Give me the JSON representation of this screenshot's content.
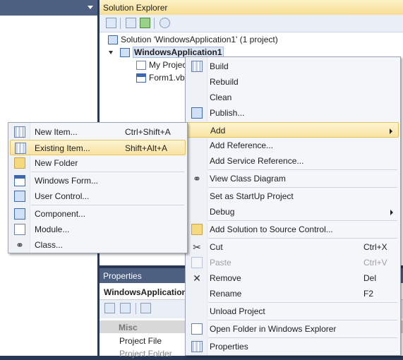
{
  "solution_explorer": {
    "title": "Solution Explorer",
    "tree": {
      "solution": "Solution 'WindowsApplication1' (1 project)",
      "project": "WindowsApplication1",
      "item1": "My Projec",
      "item2": "Form1.vb"
    }
  },
  "context_menu": {
    "items": [
      {
        "label": "Build"
      },
      {
        "label": "Rebuild"
      },
      {
        "label": "Clean"
      },
      {
        "label": "Publish..."
      },
      {
        "label": "Add"
      },
      {
        "label": "Add Reference..."
      },
      {
        "label": "Add Service Reference..."
      },
      {
        "label": "View Class Diagram"
      },
      {
        "label": "Set as StartUp Project"
      },
      {
        "label": "Debug"
      },
      {
        "label": "Add Solution to Source Control..."
      },
      {
        "label": "Cut",
        "shortcut": "Ctrl+X"
      },
      {
        "label": "Paste",
        "shortcut": "Ctrl+V"
      },
      {
        "label": "Remove",
        "shortcut": "Del"
      },
      {
        "label": "Rename",
        "shortcut": "F2"
      },
      {
        "label": "Unload Project"
      },
      {
        "label": "Open Folder in Windows Explorer"
      },
      {
        "label": "Properties"
      }
    ]
  },
  "add_submenu": {
    "items": [
      {
        "label": "New Item...",
        "shortcut": "Ctrl+Shift+A"
      },
      {
        "label": "Existing Item...",
        "shortcut": "Shift+Alt+A"
      },
      {
        "label": "New Folder"
      },
      {
        "label": "Windows Form..."
      },
      {
        "label": "User Control..."
      },
      {
        "label": "Component..."
      },
      {
        "label": "Module..."
      },
      {
        "label": "Class..."
      }
    ]
  },
  "properties": {
    "title": "Properties",
    "object": "WindowsApplication",
    "category": "Misc",
    "rows": [
      "Project File",
      "Project Folder"
    ]
  }
}
